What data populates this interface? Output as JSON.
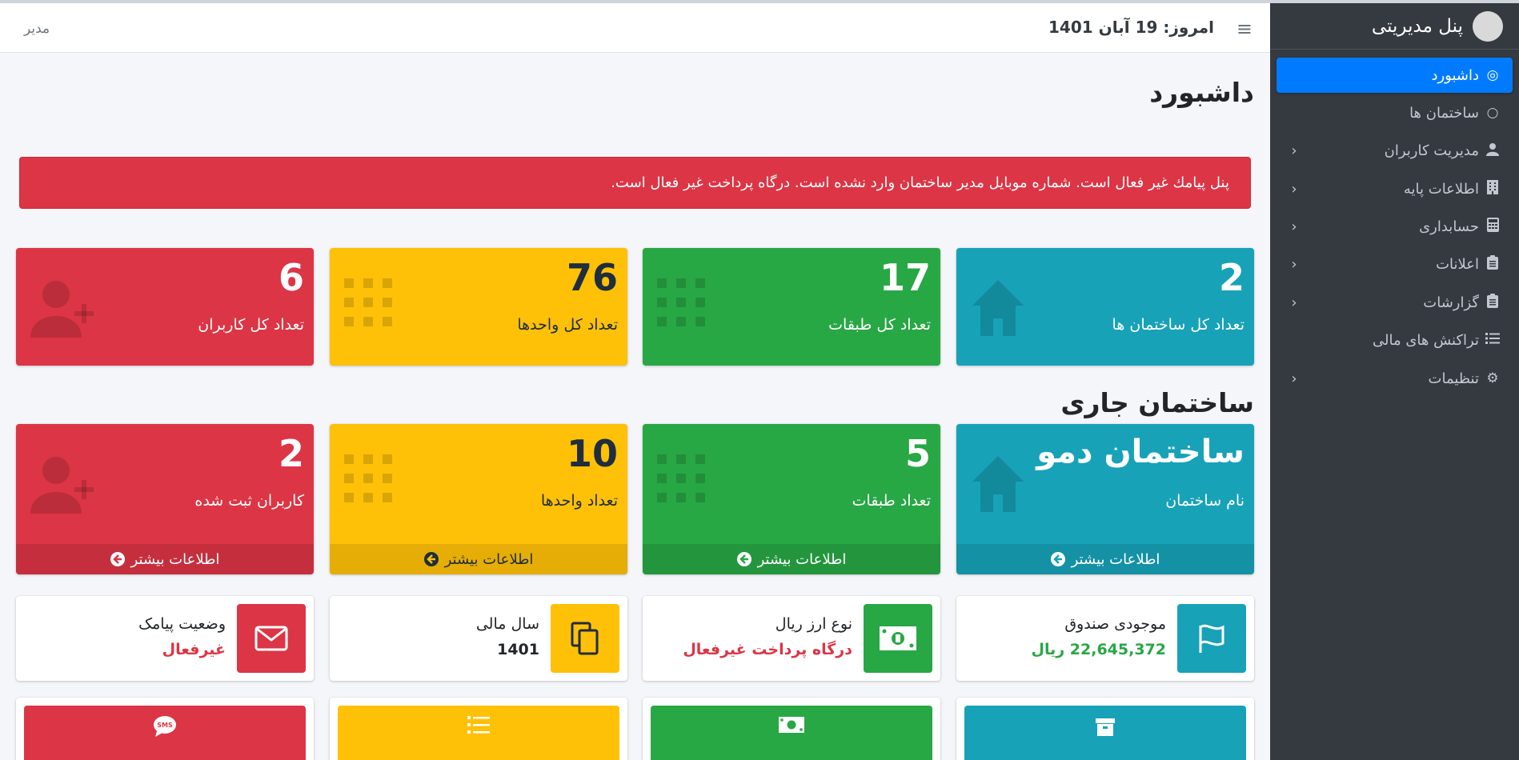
{
  "brand": {
    "title": "پنل مدیریتی"
  },
  "header": {
    "today": "امروز: 19 آبان 1401",
    "user": "مدیر"
  },
  "sidebar": {
    "items": [
      {
        "label": "داشبورد",
        "icon": "circle-dot-icon",
        "active": true
      },
      {
        "label": "ساختمان ها",
        "icon": "circle-icon"
      },
      {
        "label": "مدیریت کاربران",
        "icon": "user-icon"
      },
      {
        "label": "اطلاعات پایه",
        "icon": "building-icon"
      },
      {
        "label": "حسابداری",
        "icon": "calculator-icon"
      },
      {
        "label": "اعلانات",
        "icon": "clipboard-icon"
      },
      {
        "label": "گزارشات",
        "icon": "clipboard-icon"
      },
      {
        "label": "تراکنش های مالی",
        "icon": "list-icon"
      },
      {
        "label": "تنظیمات",
        "icon": "gear-icon"
      }
    ]
  },
  "page": {
    "title": "داشبورد"
  },
  "alert": {
    "text": "پنل پیامك غیر فعال است. شماره موبایل مدیر ساختمان وارد نشده است. درگاه پرداخت غیر فعال است."
  },
  "stats": [
    {
      "value": "2",
      "label": "تعداد کل ساختمان ها",
      "color": "#17a2b8",
      "icon": "home-icon"
    },
    {
      "value": "17",
      "label": "تعداد کل طبقات",
      "color": "#28a745",
      "icon": "grid-icon"
    },
    {
      "value": "76",
      "label": "تعداد کل واحدها",
      "color": "#ffc107",
      "icon": "grid-icon"
    },
    {
      "value": "6",
      "label": "تعداد کل کاربران",
      "color": "#dc3545",
      "icon": "user-plus-icon"
    }
  ],
  "current_building": {
    "title": "ساختمان جاری",
    "more_label": "اطلاعات بیشتر",
    "boxes": [
      {
        "value": "ساختمان دمو",
        "label": "نام ساختمان",
        "icon": "home-icon"
      },
      {
        "value": "5",
        "label": "تعداد طبقات",
        "icon": "grid-icon"
      },
      {
        "value": "10",
        "label": "تعداد واحدها",
        "icon": "grid-icon"
      },
      {
        "value": "2",
        "label": "کاربران ثبت شده",
        "icon": "user-plus-icon"
      }
    ]
  },
  "info_boxes": [
    {
      "text": "موجودی صندوق",
      "value": "22,645,372 ریال",
      "value_color": "#28a745",
      "icon": "flag-icon",
      "bg": "#17a2b8"
    },
    {
      "text": "نوع ارز ریال",
      "value": "درگاه پرداخت غیرفعال",
      "value_color": "#dc3545",
      "icon": "money-icon",
      "bg": "#28a745"
    },
    {
      "text": "سال مالی",
      "value": "1401",
      "value_color": "#212529",
      "icon": "copy-icon",
      "bg": "#ffc107"
    },
    {
      "text": "وضعیت پیامک",
      "value": "غیرفعال",
      "value_color": "#dc3545",
      "icon": "envelope-icon",
      "bg": "#dc3545"
    }
  ],
  "bottom_boxes": [
    {
      "icon": "box-icon",
      "bg": "#17a2b8"
    },
    {
      "icon": "money-icon",
      "bg": "#28a745"
    },
    {
      "icon": "list-icon",
      "bg": "#ffc107"
    },
    {
      "icon": "sms-icon",
      "bg": "#dc3545"
    }
  ]
}
